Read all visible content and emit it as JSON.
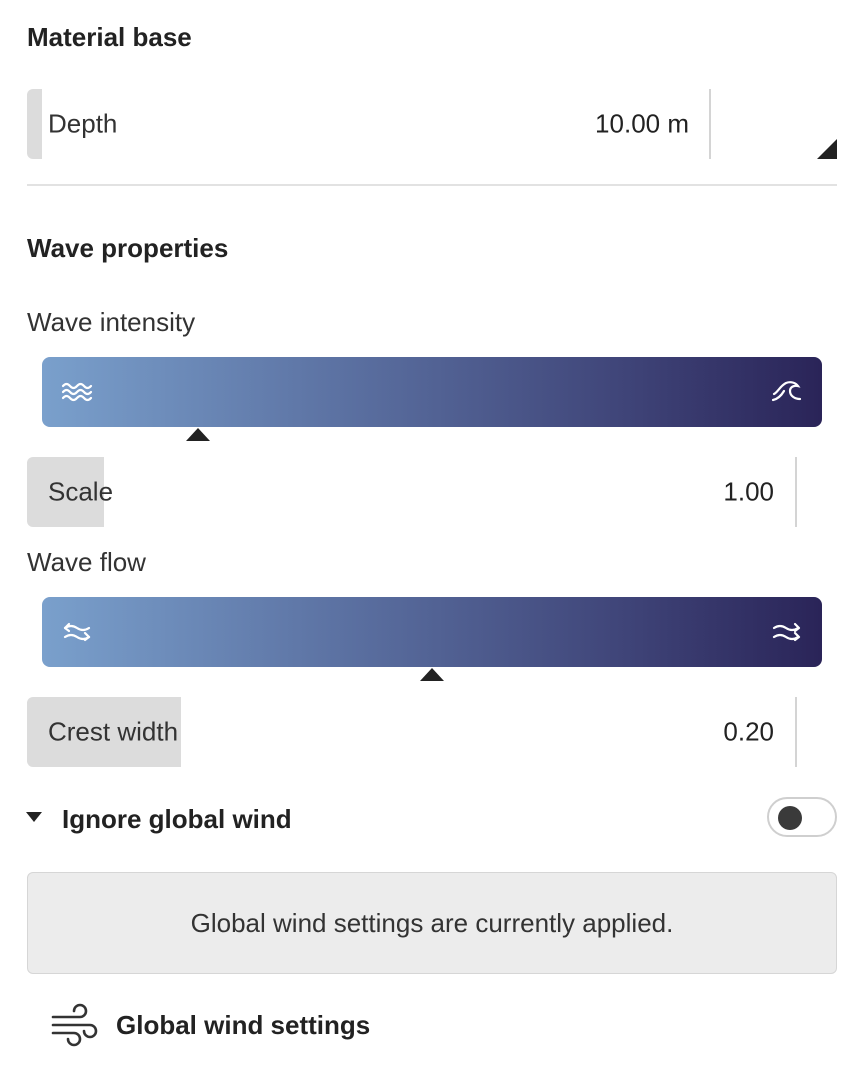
{
  "material_base": {
    "title": "Material base",
    "depth": {
      "label": "Depth",
      "value": "10.00 m"
    }
  },
  "wave_properties": {
    "title": "Wave properties",
    "intensity": {
      "label": "Wave intensity",
      "marker_fraction": 0.2,
      "left_icon": "calm-waves-icon",
      "right_icon": "breaking-wave-icon"
    },
    "scale": {
      "label": "Scale",
      "value": "1.00",
      "fill_fraction": 0.1
    },
    "flow": {
      "label": "Wave flow",
      "marker_fraction": 0.5,
      "left_icon": "mixed-flow-icon",
      "right_icon": "directional-flow-icon"
    },
    "crest_width": {
      "label": "Crest width",
      "value": "0.20",
      "fill_fraction": 0.2
    }
  },
  "ignore_global_wind": {
    "label": "Ignore global wind",
    "enabled": false,
    "info": "Global wind settings are currently applied."
  },
  "global_wind_link": {
    "label": "Global wind settings",
    "icon": "wind-icon"
  },
  "colors": {
    "gradient_start": "#7aa0cc",
    "gradient_end": "#2a2458"
  }
}
